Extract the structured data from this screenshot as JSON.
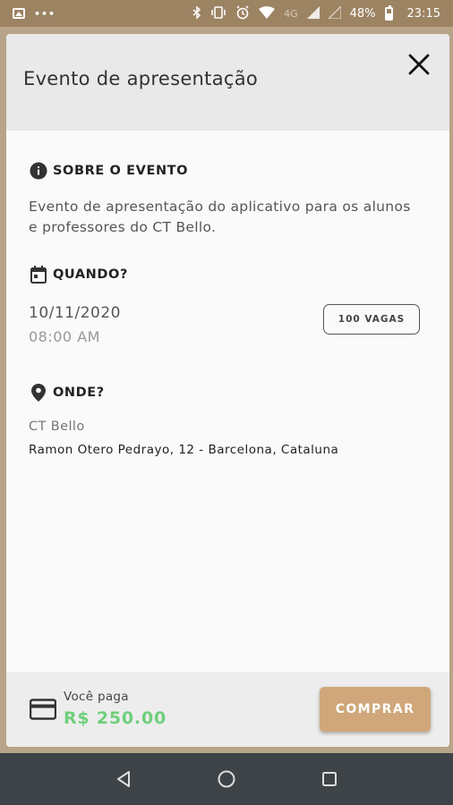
{
  "status_bar": {
    "battery": "48%",
    "time": "23:15",
    "network": "4G",
    "icons": [
      "image-icon",
      "more-dots-icon",
      "bluetooth-icon",
      "vibrate-icon",
      "alarm-icon",
      "wifi-icon",
      "signal-icon",
      "battery-icon"
    ]
  },
  "modal": {
    "title": "Evento de apresentação",
    "about": {
      "heading": "SOBRE O EVENTO",
      "text": "Evento de apresentação do aplicativo para os alunos e professores do CT Bello."
    },
    "when": {
      "heading": "QUANDO?",
      "date": "10/11/2020",
      "time": "08:00 AM",
      "vagas": "100 VAGAS"
    },
    "where": {
      "heading": "ONDE?",
      "place": "CT Bello",
      "address": "Ramon Otero Pedrayo, 12 - Barcelona, Cataluna"
    },
    "footer": {
      "pay_label": "Você paga",
      "pay_value": "R$ 250.00",
      "buy_label": "COMPRAR"
    }
  },
  "colors": {
    "accent": "#cfa77a",
    "price": "#6fcf7a",
    "status_bar": "#9c8362",
    "nav_bar": "#3d4347"
  }
}
